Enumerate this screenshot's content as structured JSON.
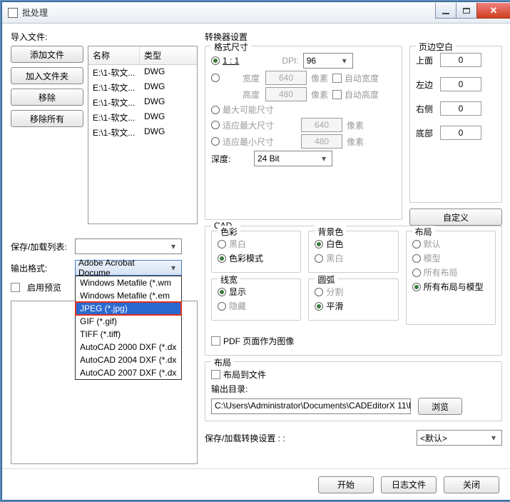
{
  "title": "批处理",
  "left": {
    "import_label": "导入文件:",
    "btn_add_file": "添加文件",
    "btn_add_folder": "加入文件夹",
    "btn_remove": "移除",
    "btn_remove_all": "移除所有",
    "col_name": "名称",
    "col_type": "类型",
    "files": [
      {
        "name": "E:\\1-软文...",
        "type": "DWG"
      },
      {
        "name": "E:\\1-软文...",
        "type": "DWG"
      },
      {
        "name": "E:\\1-软文...",
        "type": "DWG"
      },
      {
        "name": "E:\\1-软文...",
        "type": "DWG"
      },
      {
        "name": "E:\\1-软文...",
        "type": "DWG"
      }
    ],
    "save_list_label": "保存/加载列表:",
    "output_format_label": "输出格式:",
    "output_format_value": "Adobe Acrobat Docume",
    "enable_preview": "启用预览",
    "dropdown": [
      "Windows Metafile (*.wm",
      "Windows Metafile (*.em",
      "JPEG (*.jpg)",
      "GIF (*.gif)",
      "TIFF (*.tiff)",
      "AutoCAD 2000 DXF (*.dx",
      "AutoCAD 2004 DXF (*.dx",
      "AutoCAD 2007 DXF (*.dx"
    ]
  },
  "right": {
    "converter_settings": "转换器设置",
    "format_size": "格式尺寸",
    "ratio_11": "1 : 1",
    "dpi_label": "DPI:",
    "dpi_value": "96",
    "width_label": "宽度",
    "width_value": "640",
    "height_label": "高度",
    "height_value": "480",
    "pixels": "像素",
    "auto_width": "自动宽度",
    "auto_height": "自动高度",
    "max_size": "最大可能尺寸",
    "fit_max": "适应最大尺寸",
    "fit_max_v": "640",
    "fit_min": "适应最小尺寸",
    "fit_min_v": "480",
    "depth_label": "深度:",
    "depth_value": "24 Bit",
    "custom_btn": "自定义",
    "margin": {
      "legend": "页边空白",
      "top": "上面",
      "top_v": "0",
      "left": "左边",
      "left_v": "0",
      "right": "右侧",
      "right_v": "0",
      "bottom": "底部",
      "bottom_v": "0"
    },
    "cad": {
      "legend": "CAD",
      "color": "色彩",
      "color_bw": "黑白",
      "color_mode": "色彩模式",
      "bg": "背景色",
      "bg_white": "白色",
      "bg_black": "黑白",
      "layout": "布局",
      "layout_default": "默认",
      "layout_model": "模型",
      "layout_all": "所有布局",
      "layout_all_model": "所有布局与模型",
      "lw": "线宽",
      "lw_show": "显示",
      "lw_hide": "隐藏",
      "arc": "圆弧",
      "arc_split": "分割",
      "arc_smooth": "平滑"
    },
    "pdf_as_image": "PDF 页面作为图像",
    "layout_grp": "布局",
    "layout_to_file": "布局到文件",
    "outdir_label": "输出目录:",
    "outdir_value": "C:\\Users\\Administrator\\Documents\\CADEditorX 11\\D",
    "browse": "浏览",
    "save_load_settings": "保存/加载转换设置 : :",
    "default_sel": "<默认>"
  },
  "footer": {
    "start": "开始",
    "log": "日志文件",
    "close": "关闭"
  }
}
